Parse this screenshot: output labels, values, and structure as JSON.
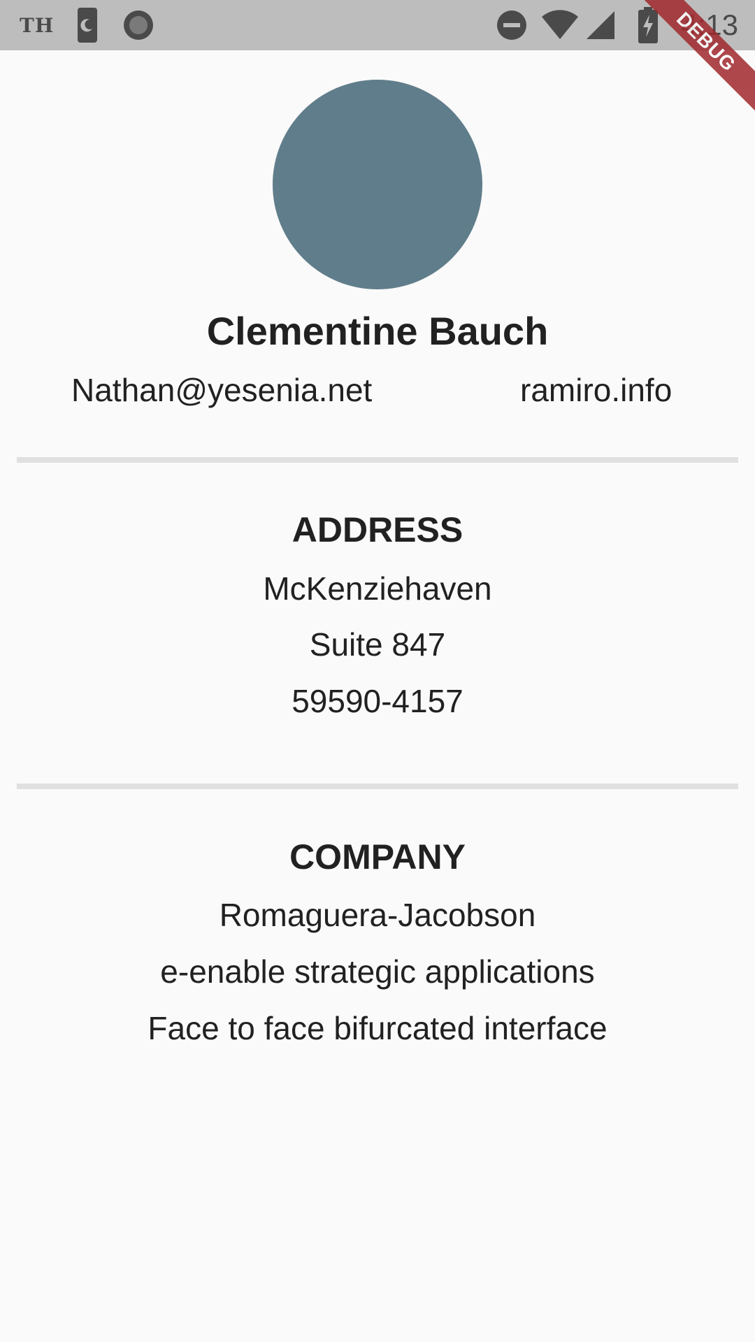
{
  "status_bar": {
    "left_label": "TH",
    "time": "4:13",
    "icons": [
      "phone-night-icon",
      "circle-icon",
      "do-not-disturb-icon",
      "wifi-icon",
      "cell-signal-icon",
      "battery-charging-icon"
    ],
    "background": "#bdbdbd"
  },
  "debug_banner": {
    "label": "DEBUG",
    "color": "#a0282d"
  },
  "profile": {
    "avatar_color": "#607d8b",
    "name": "Clementine Bauch",
    "email": "Nathan@yesenia.net",
    "website": "ramiro.info"
  },
  "address": {
    "title": "ADDRESS",
    "city": "McKenziehaven",
    "suite": "Suite 847",
    "zipcode": "59590-4157"
  },
  "company": {
    "title": "COMPANY",
    "name": "Romaguera-Jacobson",
    "bs": "e-enable strategic applications",
    "catch_phrase": "Face to face bifurcated interface"
  }
}
